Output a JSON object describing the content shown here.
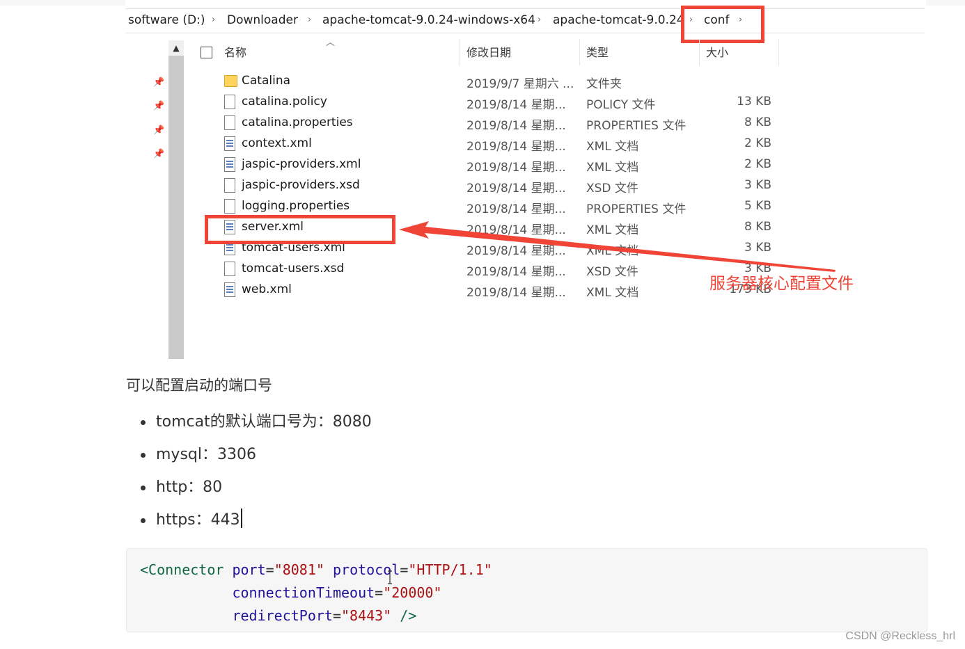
{
  "breadcrumb": {
    "items": [
      "software (D:)",
      "Downloader",
      "apache-tomcat-9.0.24-windows-x64",
      "apache-tomcat-9.0.24",
      "conf"
    ],
    "separator": "›"
  },
  "columns": {
    "name": "名称",
    "date": "修改日期",
    "type": "类型",
    "size": "大小"
  },
  "files": [
    {
      "name": "Catalina",
      "date": "2019/9/7 星期六 ...",
      "type": "文件夹",
      "size": "",
      "icon": "folder-icon"
    },
    {
      "name": "catalina.policy",
      "date": "2019/8/14 星期...",
      "type": "POLICY 文件",
      "size": "13 KB",
      "icon": "file-icon"
    },
    {
      "name": "catalina.properties",
      "date": "2019/8/14 星期...",
      "type": "PROPERTIES 文件",
      "size": "8 KB",
      "icon": "file-icon"
    },
    {
      "name": "context.xml",
      "date": "2019/8/14 星期...",
      "type": "XML 文档",
      "size": "2 KB",
      "icon": "xml-file-icon"
    },
    {
      "name": "jaspic-providers.xml",
      "date": "2019/8/14 星期...",
      "type": "XML 文档",
      "size": "2 KB",
      "icon": "xml-file-icon"
    },
    {
      "name": "jaspic-providers.xsd",
      "date": "2019/8/14 星期...",
      "type": "XSD 文件",
      "size": "3 KB",
      "icon": "file-icon"
    },
    {
      "name": "logging.properties",
      "date": "2019/8/14 星期...",
      "type": "PROPERTIES 文件",
      "size": "5 KB",
      "icon": "file-icon"
    },
    {
      "name": "server.xml",
      "date": "2019/8/14 星期...",
      "type": "XML 文档",
      "size": "8 KB",
      "icon": "xml-file-icon"
    },
    {
      "name": "tomcat-users.xml",
      "date": "2019/8/14 星期...",
      "type": "XML 文档",
      "size": "3 KB",
      "icon": "xml-file-icon"
    },
    {
      "name": "tomcat-users.xsd",
      "date": "2019/8/14 星期...",
      "type": "XSD 文件",
      "size": "3 KB",
      "icon": "file-icon"
    },
    {
      "name": "web.xml",
      "date": "2019/8/14 星期...",
      "type": "XML 文档",
      "size": "173 KB",
      "icon": "xml-file-icon"
    }
  ],
  "annotation": {
    "text": "服务器核心配置文件",
    "color": "#ef4436"
  },
  "article": {
    "paragraph": "可以配置启动的端口号",
    "bullets": [
      "tomcat的默认端口号为：8080",
      "mysql：3306",
      "http：80",
      "https：443"
    ]
  },
  "code": {
    "line1": {
      "open": "<Connector",
      "a1": "port",
      "v1": "\"8081\"",
      "a2": "protocol",
      "v2": "\"HTTP/1.1\""
    },
    "line2": {
      "a": "connectionTimeout",
      "v": "\"20000\""
    },
    "line3": {
      "a": "redirectPort",
      "v": "\"8443\"",
      "close": "/>"
    }
  },
  "watermark": "CSDN @Reckless_hrl",
  "colors": {
    "highlight": "#ef4436",
    "tag": "#116644",
    "attr": "#221199",
    "string": "#aa1111"
  }
}
